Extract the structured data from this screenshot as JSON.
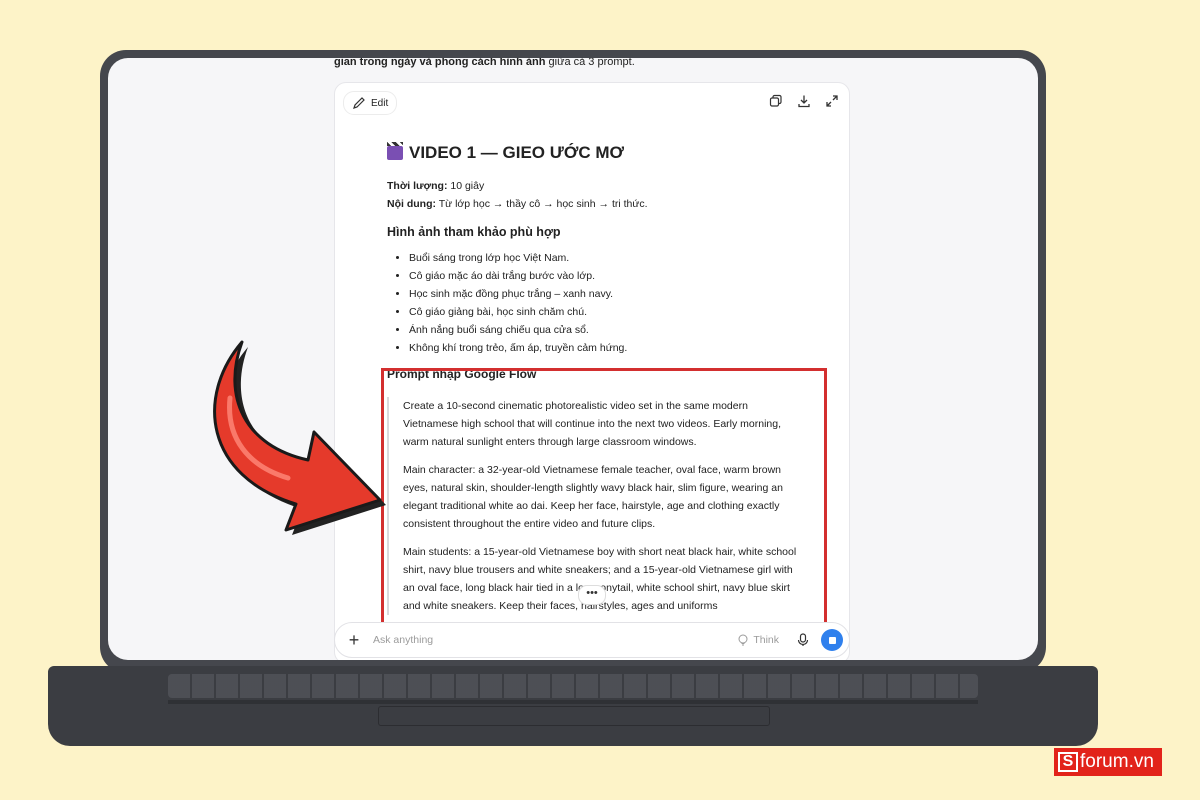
{
  "intro": {
    "bold_part": "gian trong ngày và phong cách hình ảnh",
    "rest": " giữa cả 3 prompt."
  },
  "canvas": {
    "edit_label": "Edit",
    "title": "VIDEO 1 — GIEO ƯỚC MƠ",
    "title_icon": "clapperboard-icon",
    "duration_label": "Thời lượng:",
    "duration_value": " 10 giây",
    "content_label": "Nội dung:",
    "content_value": " Từ lớp học → thầy cô → học sinh → tri thức.",
    "refs_heading": "Hình ảnh tham khảo phù hợp",
    "refs": [
      "Buổi sáng trong lớp học Việt Nam.",
      "Cô giáo mặc áo dài trắng bước vào lớp.",
      "Học sinh mặc đồng phục trắng – xanh navy.",
      "Cô giáo giảng bài, học sinh chăm chú.",
      "Ánh nắng buổi sáng chiếu qua cửa sổ.",
      "Không khí trong trẻo, ấm áp, truyền cảm hứng."
    ],
    "prompt_heading": "Prompt nhập Google Flow",
    "prompt_paragraphs": [
      "Create a 10-second cinematic photorealistic video set in the same modern Vietnamese high school that will continue into the next two videos. Early morning, warm natural sunlight enters through large classroom windows.",
      "Main character: a 32-year-old Vietnamese female teacher, oval face, warm brown eyes, natural skin, shoulder-length slightly wavy black hair, slim figure, wearing an elegant traditional white ao dai. Keep her face, hairstyle, age and clothing exactly consistent throughout the entire video and future clips.",
      "Main students: a 15-year-old Vietnamese boy with short neat black hair, white school shirt, navy blue trousers and white sneakers; and a 15-year-old Vietnamese girl with an oval face, long black hair tied in a low ponytail, white school shirt, navy blue skirt and white sneakers. Keep their faces, hairstyles, ages and uniforms"
    ],
    "more_label": "•••"
  },
  "composer": {
    "placeholder": "Ask anything",
    "think_label": "Think"
  },
  "brand": {
    "letter": "S",
    "text": "forum.vn"
  },
  "colors": {
    "highlight": "#d32f2f",
    "send": "#2f80ed",
    "background": "#fdf3c8",
    "arrow": "#e53a2b"
  }
}
